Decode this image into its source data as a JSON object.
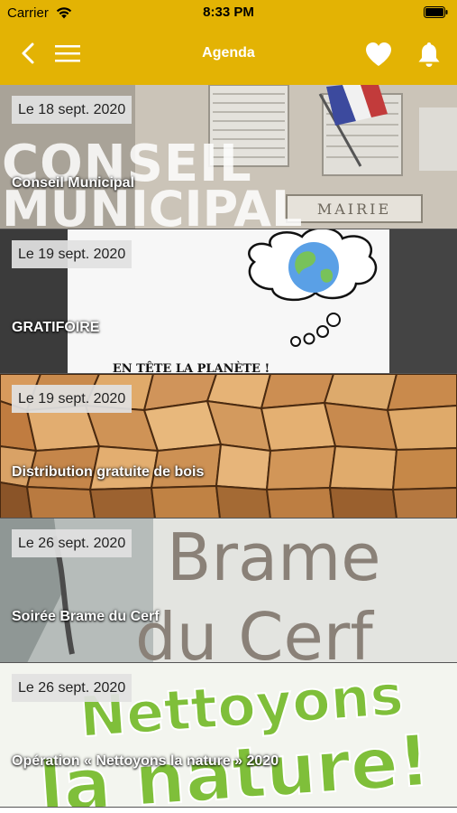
{
  "status_bar": {
    "carrier": "Carrier",
    "time": "8:33 PM"
  },
  "header": {
    "title": "Agenda",
    "background_color": "#e3b304",
    "icons": [
      "chevron-left-icon",
      "hamburger-menu-icon",
      "heart-icon",
      "bell-icon"
    ]
  },
  "events": [
    {
      "date": "Le 18 sept. 2020",
      "title": "Conseil Municipal",
      "image_text": [
        "CONSEIL",
        "MUNICIPAL",
        "MAIRIE"
      ]
    },
    {
      "date": "Le 19 sept. 2020",
      "title": "GRATIFOIRE",
      "image_text": [
        "EN TÊTE LA PLANÈTE !"
      ]
    },
    {
      "date": "Le 19 sept. 2020",
      "title": "Distribution gratuite de bois",
      "image_text": []
    },
    {
      "date": "Le 26 sept. 2020",
      "title": "Soirée Brame du Cerf",
      "image_text": [
        "Brame",
        "du Cerf"
      ]
    },
    {
      "date": "Le 26 sept. 2020",
      "title": "Opération « Nettoyons la nature » 2020",
      "image_text": [
        "Nettoyons",
        "la nature!"
      ]
    }
  ]
}
